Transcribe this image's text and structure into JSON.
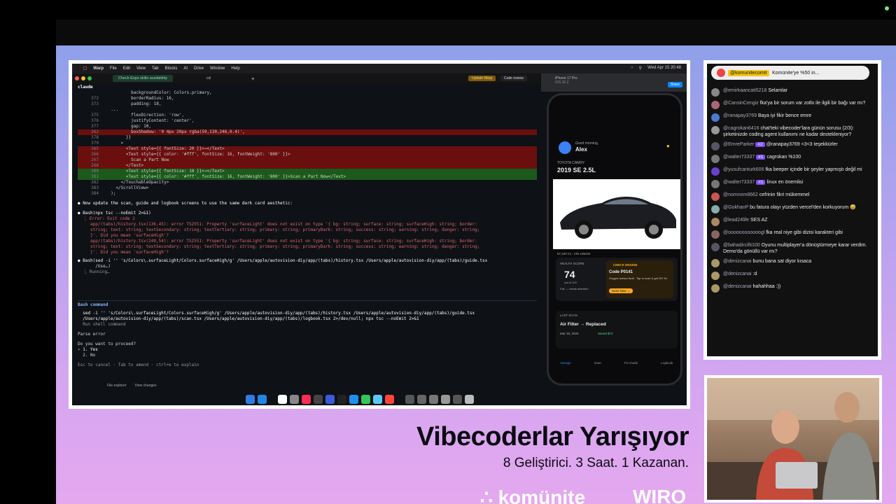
{
  "menubar": {
    "items": [
      "Warp",
      "File",
      "Edit",
      "View",
      "Tab",
      "Blocks",
      "AI",
      "Drive",
      "Window",
      "Help"
    ],
    "clock": "Wed Apr 15  20:48"
  },
  "tabbar": {
    "active_tab": "Check Expo skills availability",
    "second_tab": "cd",
    "update_btn": "Update Warp",
    "code_review_btn": "Code review"
  },
  "terminal": {
    "session": "claude",
    "diff_lines": [
      {
        "n": "",
        "t": "          backgroundColor: Colors.primary,",
        "k": ""
      },
      {
        "n": "372",
        "t": "          borderRadius: 16,",
        "k": ""
      },
      {
        "n": "373",
        "t": "          padding: 18,",
        "k": ""
      },
      {
        "n": "",
        "t": "  ...",
        "k": ""
      },
      {
        "n": "375",
        "t": "          flexDirection: 'row',",
        "k": ""
      },
      {
        "n": "376",
        "t": "          justifyContent: 'center',",
        "k": ""
      },
      {
        "n": "377",
        "t": "          gap: 10,",
        "k": ""
      },
      {
        "n": "262",
        "t": "          boxShadow: '0 4px 20px rgba(59,130,246,0.4)',",
        "k": "del"
      },
      {
        "n": "378",
        "t": "        }}",
        "k": ""
      },
      {
        "n": "379",
        "t": "      >",
        "k": ""
      },
      {
        "n": "265",
        "t": "        <Text style={{ fontSize: 20 }}>→</Text>",
        "k": "del"
      },
      {
        "n": "266",
        "t": "        <Text style={{ color: '#fff', fontSize: 16, fontWeight: '800' }}>",
        "k": "del"
      },
      {
        "n": "267",
        "t": "          Scan a Part Now",
        "k": "del"
      },
      {
        "n": "268",
        "t": "        </Text>",
        "k": "del"
      },
      {
        "n": "380",
        "t": "        <Text style={{ fontSize: 18 }}>→</Text>",
        "k": "add"
      },
      {
        "n": "381",
        "t": "        <Text style={{ color: '#fff', fontSize: 16, fontWeight: '800' }}>Scan a Part Now</Text>",
        "k": "add"
      },
      {
        "n": "382",
        "t": "      </TouchableOpacity>",
        "k": ""
      },
      {
        "n": "383",
        "t": "    </ScrollView>",
        "k": ""
      },
      {
        "n": "384",
        "t": "  );",
        "k": ""
      }
    ],
    "bullet1": "● Now update the scan, guide and logbook screens to use the same dark card aesthetic:",
    "bash1": "● Bash(npx tsc --noEmit 2>&1)",
    "error_lines": [
      "  ⎿ Error: Exit code 2",
      "     app/(tabs)/history.tsx(136,45): error TS2551: Property 'surfaceLight' does not exist on type '{ bg: string; surface: string; surfaceHigh: string; border:",
      "     string; text: string; textSecondary: string; textTertiary: string; primary: string; primaryDark: string; success: string; warning: string; danger: string;",
      "     }'. Did you mean 'surfaceHigh'?",
      "     app/(tabs)/history.tsx(249,54): error TS2551: Property 'surfaceLight' does not exist on type '{ bg: string; surface: string; surfaceHigh: string; border:",
      "     string; text: string; textSecondary: string; textTertiary: string; primary: string; primaryDark: string; success: string; warning: string; danger: string;",
      "     }'. Did you mean 'surfaceHigh'?"
    ],
    "bash2": "● Bash(sed -i '' 's/Colors\\.surfaceLight/Colors.surfaceHigh/g' /Users/apple/autovision-diy/app/(tabs)/history.tsx /Users/apple/autovision-diy/app/(tabs)/guide.tsx",
    "bash2b": "       /Use…)",
    "running": "  ⎿ Running…"
  },
  "bashbox": {
    "title": "Bash command",
    "cmd1": "  sed -i '' 's/Colors\\.surfaceLight/Colors.surfaceHigh/g' /Users/apple/autovision-diy/app/(tabs)/history.tsx /Users/apple/autovision-diy/app/(tabs)/guide.tsx",
    "cmd2": "  /Users/apple/autovision-diy/app/(tabs)/scan.tsx /Users/apple/autovision-diy/app/(tabs)/logbook.tsx 2>/dev/null; npx tsc --noEmit 2>&1",
    "cmd3": "  Run shell command",
    "parse": "Parse error",
    "ask": "Do you want to proceed?",
    "opt1": "› 1. Yes",
    "opt2": "  2. No",
    "hint": "Esc to cancel · Tab to amend · ctrl+e to explain"
  },
  "status": {
    "file_explorer": "File explorer",
    "view_changes": "View changes"
  },
  "simulator": {
    "device": "iPhone 17 Pro",
    "os": "iOS 26.2",
    "share": "Share"
  },
  "app": {
    "greeting": "Good morning,",
    "name": "Alex",
    "brand": "TOYOTA CAMRY",
    "model": "2019 SE 2.5L",
    "mileage": "67,420 mi · VIN 196432",
    "health_label": "HEALTH SCORE",
    "health_value": "74",
    "health_sub": "out of 100",
    "health_note": "Fair — needs attention",
    "check_engine": "CHECK ENGINE",
    "code": "Code P0141",
    "code_desc": "Oxygen sensor fault · Tap to scan & get DIY fix",
    "scan_now": "Scan Now →",
    "last_scan": "LAST SCAN",
    "part": "Air Filter → Replaced",
    "date": "Mar 28, 2026",
    "saved": "Saved $73",
    "tabs": [
      "Garage",
      "Scan",
      "Fix Guide",
      "Logbook"
    ]
  },
  "chat": {
    "pinned_user": "@komunitecomtr",
    "pinned_text": "Komünite'ye %50 in...",
    "messages": [
      {
        "u": "@emirkaancati5218",
        "t": "Selamlar",
        "c": "#888",
        "b": ""
      },
      {
        "u": "@CansinCengiz",
        "t": "fka'ya bir sorum var zotlo ile ilgili bir bağı var mı?",
        "c": "#a67",
        "b": ""
      },
      {
        "u": "@ranapay3769",
        "t": "Baya iyi fikir bence emre",
        "c": "#4a7bd0",
        "b": ""
      },
      {
        "u": "@cagrokan6416",
        "t": "chat'teki vibecoder'lara günün sorusu (2/3): şirketinizde coding agent kullanımı ne kadar destekleniyor?",
        "c": "#999",
        "b": ""
      },
      {
        "u": "@EmreParker",
        "t": "@ranapay3769 <3<3 teşekkürler",
        "c": "#556",
        "b": "#2"
      },
      {
        "u": "@walter73337",
        "t": "cagrokan %100",
        "c": "#777",
        "b": "#1"
      },
      {
        "u": "@yusufcanturk606",
        "t": "fka beeper içinde bir şeyler yapmıştı değil mi",
        "c": "#6a3fd0",
        "b": ""
      },
      {
        "u": "@walter73337",
        "t": "linux en önemlisi",
        "c": "#777",
        "b": "#1"
      },
      {
        "u": "@nomnom8662",
        "t": "cefrinin fikri mükemmel",
        "c": "#c55",
        "b": ""
      },
      {
        "u": "@GokhanP",
        "t": "bu fatura olayı yüzden vercel'den korkuyorum 😅",
        "c": "#8aa",
        "b": ""
      },
      {
        "u": "@lead24life",
        "t": "SES AZ",
        "c": "#a86",
        "b": ""
      },
      {
        "u": "@oooooooooooogl",
        "t": "fka real niye gibi dizisi karakteri gibi",
        "c": "#866",
        "b": ""
      },
      {
        "u": "@bahadircifti100",
        "t": "Oyunu multiplayer'a dönüştürmeye karar verdim. Demo'da gönüllü var mı?",
        "c": "#556",
        "b": ""
      },
      {
        "u": "@denizcanai",
        "t": "bunu bana sat diyor kısaca",
        "c": "#a96",
        "b": ""
      },
      {
        "u": "@denizcanai",
        "t": ":d",
        "c": "#a96",
        "b": ""
      },
      {
        "u": "@denizcanai",
        "t": "hahahhaa :))",
        "c": "#a96",
        "b": ""
      }
    ]
  },
  "overlay": {
    "title": "Vibecoderlar Yarışıyor",
    "subtitle": "8 Geliştirici. 3 Saat. 1 Kazanan.",
    "logo1": "∴ komünite",
    "logo2": "WIRO"
  }
}
